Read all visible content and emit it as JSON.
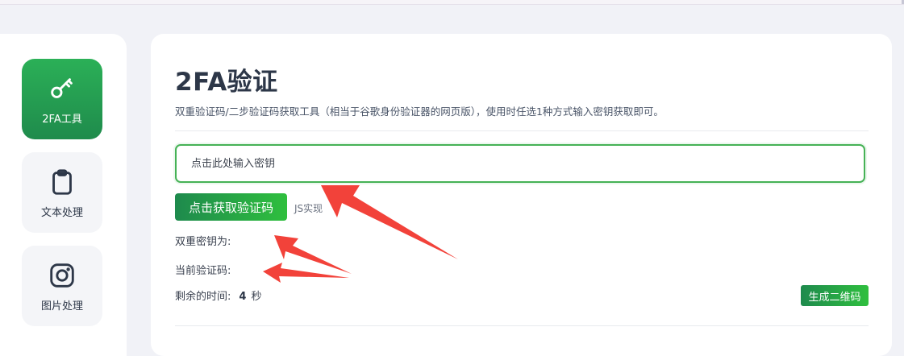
{
  "sidebar": {
    "items": [
      {
        "label": "2FA工具",
        "icon": "key-icon",
        "active": true
      },
      {
        "label": "文本处理",
        "icon": "clipboard-icon",
        "active": false
      },
      {
        "label": "图片处理",
        "icon": "instagram-icon",
        "active": false
      }
    ]
  },
  "main": {
    "title": "2FA验证",
    "description": "双重验证码/二步验证码获取工具（相当于谷歌身份验证器的网页版），使用时任选1种方式输入密钥获取即可。",
    "key_input": {
      "placeholder": "点击此处输入密钥",
      "value": ""
    },
    "get_button_label": "点击获取验证码",
    "js_note": "JS实现",
    "secret_label": "双重密钥为:",
    "code_label": "当前验证码:",
    "remaining_label": "剩余的时间:",
    "remaining_value": "4",
    "remaining_unit": "秒",
    "qr_button_label": "生成二维码"
  },
  "colors": {
    "accent_green": "#2bb057",
    "annotation_red": "#f2423a"
  }
}
